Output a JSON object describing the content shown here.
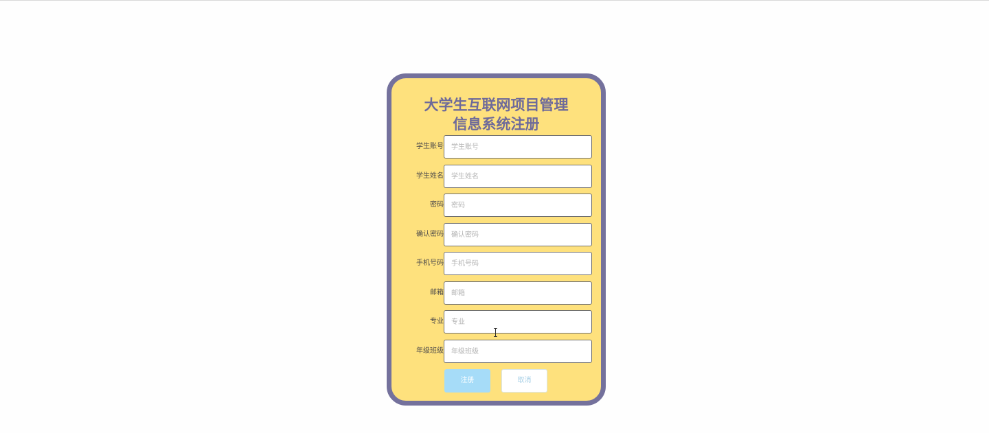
{
  "form": {
    "title_line1": "大学生互联网项目管理",
    "title_line2": "信息系统注册",
    "fields": [
      {
        "label": "学生账号",
        "placeholder": "学生账号",
        "value": ""
      },
      {
        "label": "学生姓名",
        "placeholder": "学生姓名",
        "value": ""
      },
      {
        "label": "密码",
        "placeholder": "密码",
        "value": ""
      },
      {
        "label": "确认密码",
        "placeholder": "确认密码",
        "value": ""
      },
      {
        "label": "手机号码",
        "placeholder": "手机号码",
        "value": ""
      },
      {
        "label": "邮箱",
        "placeholder": "邮箱",
        "value": ""
      },
      {
        "label": "专业",
        "placeholder": "专业",
        "value": ""
      },
      {
        "label": "年级班级",
        "placeholder": "年级班级",
        "value": ""
      }
    ],
    "register_label": "注册",
    "cancel_label": "取消"
  },
  "colors": {
    "card_background": "#fee17d",
    "card_border": "#74719c",
    "title": "#6e6a9a",
    "register_button": "#a6dcf8"
  }
}
